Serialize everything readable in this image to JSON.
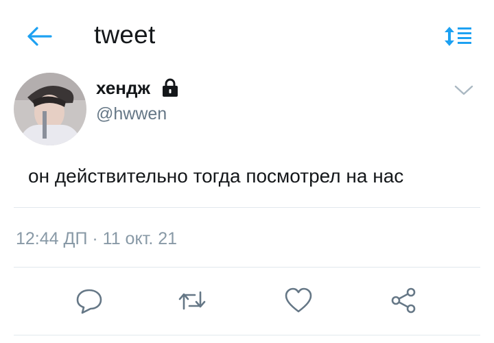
{
  "header": {
    "title": "tweet",
    "back_icon": "back-arrow-icon",
    "sort_icon": "sort-updown-icon"
  },
  "tweet": {
    "author_name": "хендж",
    "handle": "@hwwen",
    "protected_icon": "lock-icon",
    "menu_icon": "chevron-down-icon",
    "text": "он действительно тогда посмотрел на нас",
    "time": "12:44 ДП",
    "separator": " · ",
    "date": "11 окт. 21"
  },
  "actions": [
    {
      "icon": "reply-icon"
    },
    {
      "icon": "retweet-icon"
    },
    {
      "icon": "like-icon"
    },
    {
      "icon": "share-icon"
    }
  ],
  "colors": {
    "accent": "#1da1f2",
    "text": "#14171a",
    "secondary": "#657786",
    "meta": "#8899a6",
    "divider": "#e1e8ed"
  }
}
